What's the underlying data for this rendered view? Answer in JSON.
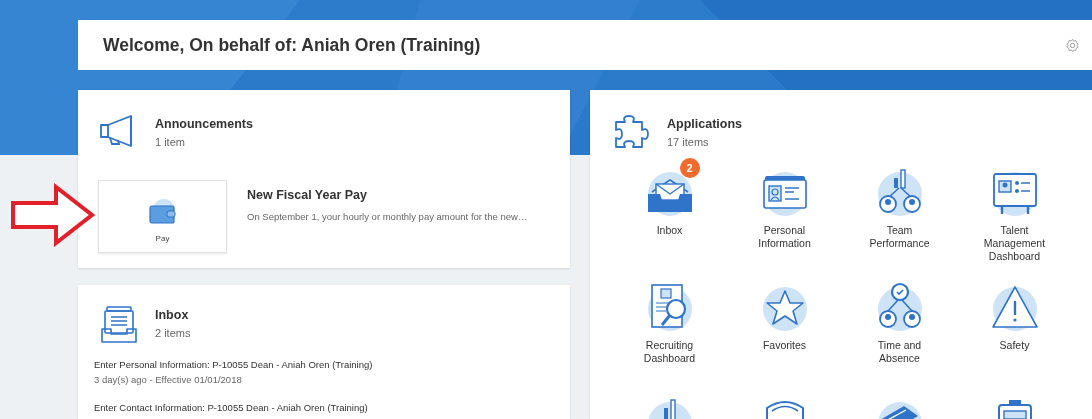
{
  "welcome": {
    "title": "Welcome, On behalf of: Aniah Oren (Training)"
  },
  "announcements": {
    "title": "Announcements",
    "count": "1 item",
    "items": [
      {
        "tile_label": "Pay",
        "title": "New Fiscal Year Pay",
        "summary": "On September 1, your hourly or monthly pay amount for the new…"
      }
    ]
  },
  "inbox": {
    "title": "Inbox",
    "count": "2 items",
    "tasks": [
      {
        "title": "Enter Personal Information: P-10055 Dean - Aniah Oren (Training)",
        "meta": "3 day(s) ago - Effective 01/01/2018"
      },
      {
        "title": "Enter Contact Information: P-10055 Dean - Aniah Oren (Training)"
      }
    ]
  },
  "applications": {
    "title": "Applications",
    "count": "17 items",
    "apps": [
      {
        "label": "Inbox",
        "badge": "2"
      },
      {
        "label": "Personal Information"
      },
      {
        "label": "Team Performance"
      },
      {
        "label": "Talent Management Dashboard"
      },
      {
        "label": "Recruiting Dashboard"
      },
      {
        "label": "Favorites"
      },
      {
        "label": "Time and Absence"
      },
      {
        "label": "Safety"
      }
    ]
  }
}
